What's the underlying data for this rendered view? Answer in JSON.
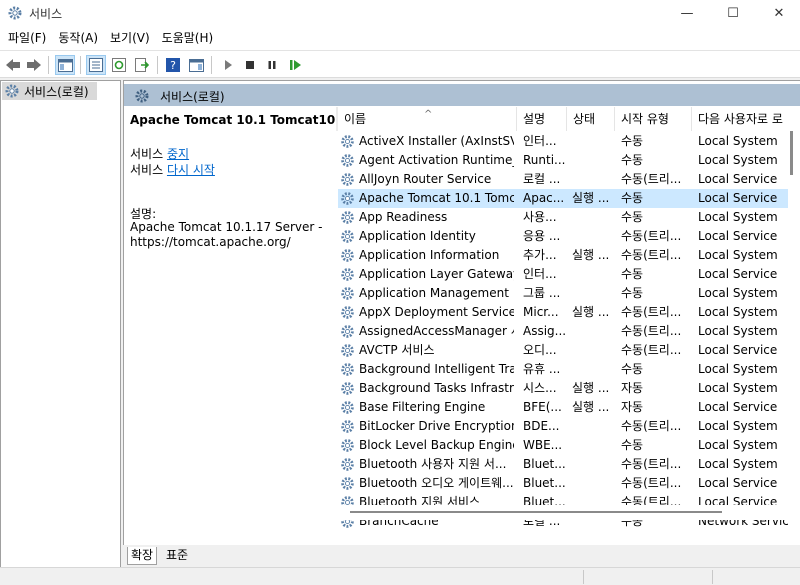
{
  "window": {
    "title": "서비스",
    "minimize": "—",
    "maximize": "☐",
    "close": "✕"
  },
  "menu": [
    "파일(F)",
    "동작(A)",
    "보기(V)",
    "도움말(H)"
  ],
  "tree": {
    "root": "서비스(로컬)"
  },
  "content_header": {
    "title": "서비스(로컬)"
  },
  "detail": {
    "service_name": "Apache Tomcat 10.1 Tomcat10",
    "prefix": "서비스",
    "stop_link": "중지",
    "restart_link": "다시 시작",
    "description_label": "설명:",
    "description": "Apache Tomcat 10.1.17 Server - https://tomcat.apache.org/"
  },
  "columns": {
    "name": "이름",
    "description": "설명",
    "status": "상태",
    "startup": "시작 유형",
    "logon": "다음 사용자로 로"
  },
  "rows": [
    {
      "name": "ActiveX Installer (AxInstSV)",
      "desc": "인터...",
      "status": "",
      "startup": "수동",
      "logon": "Local System"
    },
    {
      "name": "Agent Activation Runtime_...",
      "desc": "Runti...",
      "status": "",
      "startup": "수동",
      "logon": "Local System"
    },
    {
      "name": "AllJoyn Router Service",
      "desc": "로컬 ...",
      "status": "",
      "startup": "수동(트리...",
      "logon": "Local Service"
    },
    {
      "name": "Apache Tomcat 10.1 Tomc...",
      "desc": "Apac...",
      "status": "실행 ...",
      "startup": "수동",
      "logon": "Local Service"
    },
    {
      "name": "App Readiness",
      "desc": "사용...",
      "status": "",
      "startup": "수동",
      "logon": "Local System"
    },
    {
      "name": "Application Identity",
      "desc": "응용 ...",
      "status": "",
      "startup": "수동(트리...",
      "logon": "Local Service"
    },
    {
      "name": "Application Information",
      "desc": "추가...",
      "status": "실행 ...",
      "startup": "수동(트리...",
      "logon": "Local System"
    },
    {
      "name": "Application Layer Gateway ...",
      "desc": "인터...",
      "status": "",
      "startup": "수동",
      "logon": "Local Service"
    },
    {
      "name": "Application Management",
      "desc": "그룹 ...",
      "status": "",
      "startup": "수동",
      "logon": "Local System"
    },
    {
      "name": "AppX Deployment Service ...",
      "desc": "Micr...",
      "status": "실행 ...",
      "startup": "수동(트리...",
      "logon": "Local System"
    },
    {
      "name": "AssignedAccessManager 서...",
      "desc": "Assig...",
      "status": "",
      "startup": "수동(트리...",
      "logon": "Local System"
    },
    {
      "name": "AVCTP 서비스",
      "desc": "오디...",
      "status": "",
      "startup": "수동(트리...",
      "logon": "Local Service"
    },
    {
      "name": "Background Intelligent Tra...",
      "desc": "유휴 ...",
      "status": "",
      "startup": "수동",
      "logon": "Local System"
    },
    {
      "name": "Background Tasks Infrastru...",
      "desc": "시스...",
      "status": "실행 ...",
      "startup": "자동",
      "logon": "Local System"
    },
    {
      "name": "Base Filtering Engine",
      "desc": "BFE(...",
      "status": "실행 ...",
      "startup": "자동",
      "logon": "Local Service"
    },
    {
      "name": "BitLocker Drive Encryption ...",
      "desc": "BDE...",
      "status": "",
      "startup": "수동(트리...",
      "logon": "Local System"
    },
    {
      "name": "Block Level Backup Engine ...",
      "desc": "WBE...",
      "status": "",
      "startup": "수동",
      "logon": "Local System"
    },
    {
      "name": "Bluetooth 사용자 지원 서...",
      "desc": "Bluet...",
      "status": "",
      "startup": "수동(트리...",
      "logon": "Local System"
    },
    {
      "name": "Bluetooth 오디오 게이트웨...",
      "desc": "Bluet...",
      "status": "",
      "startup": "수동(트리...",
      "logon": "Local Service"
    },
    {
      "name": "Bluetooth 지원 서비스",
      "desc": "Bluet...",
      "status": "",
      "startup": "수동(트리...",
      "logon": "Local Service"
    },
    {
      "name": "BranchCache",
      "desc": "로컬 ...",
      "status": "",
      "startup": "수동",
      "logon": "Network Service"
    }
  ],
  "selected_row": 3,
  "tabs": {
    "extended": "확장",
    "standard": "표준"
  }
}
